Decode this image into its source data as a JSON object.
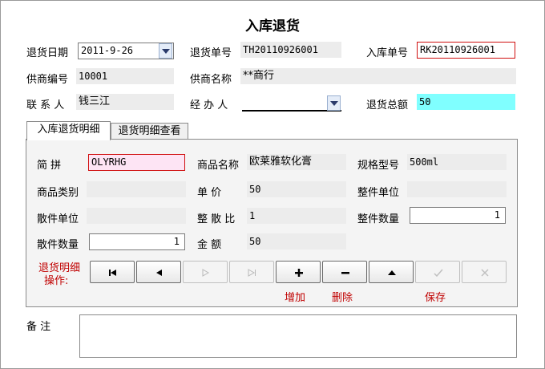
{
  "title": "入库退货",
  "header": {
    "return_date_label": "退货日期",
    "return_date_value": "2011-9-26",
    "return_no_label": "退货单号",
    "return_no_value": "TH20110926001",
    "inbound_no_label": "入库单号",
    "inbound_no_value": "RK20110926001",
    "supplier_code_label": "供商编号",
    "supplier_code_value": "10001",
    "supplier_name_label": "供商名称",
    "supplier_name_value": "**商行",
    "contact_label": "联 系 人",
    "contact_value": "钱三江",
    "handler_label": "经 办 人",
    "handler_value": "",
    "total_label": "退货总额",
    "total_value": "50"
  },
  "tabs": [
    {
      "label": "入库退货明细",
      "active": true
    },
    {
      "label": "退货明细查看",
      "active": false
    }
  ],
  "detail": {
    "pinyin_label": "简    拼",
    "pinyin_value": "OLYRHG",
    "product_name_label": "商品名称",
    "product_name_value": "欧莱雅软化膏",
    "spec_label": "规格型号",
    "spec_value": "500ml",
    "category_label": "商品类别",
    "category_value": "",
    "unit_price_label": "单    价",
    "unit_price_value": "50",
    "whole_unit_label": "整件单位",
    "whole_unit_value": "",
    "loose_unit_label": "散件单位",
    "loose_unit_value": "",
    "ratio_label": "整 散 比",
    "ratio_value": "1",
    "whole_qty_label": "整件数量",
    "whole_qty_value": "1",
    "loose_qty_label": "散件数量",
    "loose_qty_value": "1",
    "amount_label": "金    额",
    "amount_value": "50"
  },
  "ops": {
    "label_line1": "退货明细",
    "label_line2": "操作:",
    "add_label": "增加",
    "delete_label": "删除",
    "save_label": "保存"
  },
  "remarks_label": "备    注",
  "remarks_value": "",
  "colors": {
    "required_border": "#d01010",
    "pinyin_bg": "#fde4f4",
    "total_bg": "#80ffff",
    "ops_red": "#c00000"
  }
}
